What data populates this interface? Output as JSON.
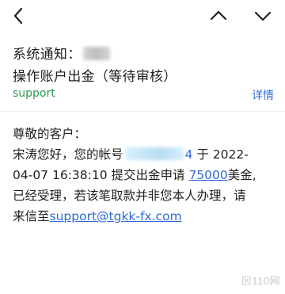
{
  "header": {
    "back_icon": "chevron-left-icon",
    "prev_icon": "chevron-up-icon",
    "next_icon": "chevron-down-icon"
  },
  "subject": {
    "prefix": "系统通知：",
    "suffix": "操作账户出金（等待审核）"
  },
  "sender": {
    "name": "support",
    "details_label": "详情"
  },
  "body": {
    "greeting": "尊敬的客户：",
    "line1_a": "宋涛您好，您的帐号",
    "line1_acct_tail": "4",
    "line1_b": "于 2022-",
    "line2_a": "04-07 16:38:10 提交出金申请 ",
    "amount": "75000",
    "line2_b": "美金,",
    "line3": "已经受理，若该笔取款并非您本人办理，请",
    "line4_a": "来信至",
    "email": "support@tgkk-fx.com"
  },
  "watermark": "⊠110网",
  "colors": {
    "accent_blue": "#2e6bd8",
    "sender_green": "#2d9a4e"
  }
}
